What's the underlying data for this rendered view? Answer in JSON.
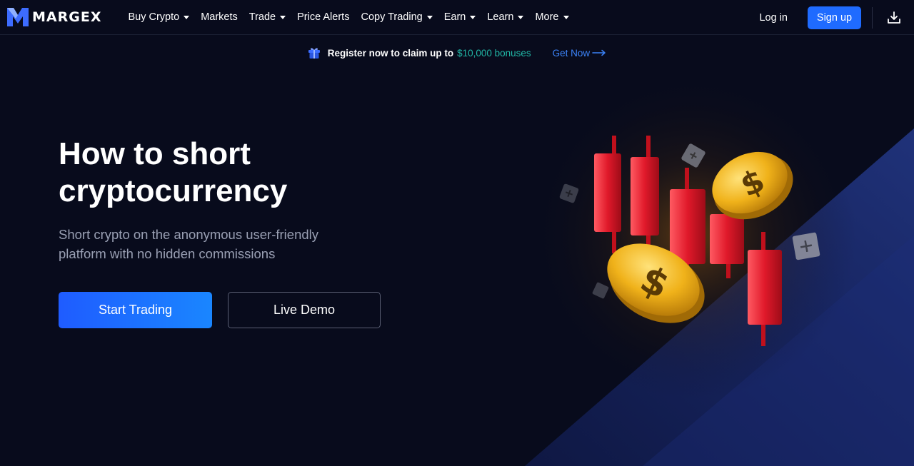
{
  "brand": {
    "name": "MARGEX"
  },
  "nav": {
    "items": [
      {
        "label": "Buy Crypto",
        "has_dropdown": true
      },
      {
        "label": "Markets",
        "has_dropdown": false
      },
      {
        "label": "Trade",
        "has_dropdown": true
      },
      {
        "label": "Price Alerts",
        "has_dropdown": false
      },
      {
        "label": "Copy Trading",
        "has_dropdown": true
      },
      {
        "label": "Earn",
        "has_dropdown": true
      },
      {
        "label": "Learn",
        "has_dropdown": true
      },
      {
        "label": "More",
        "has_dropdown": true
      }
    ],
    "login_label": "Log in",
    "signup_label": "Sign up",
    "download_icon": "download-icon"
  },
  "promo": {
    "icon": "gift-icon",
    "text": "Register now to claim up to",
    "amount": "$10,000 bonuses",
    "link_label": "Get Now",
    "link_icon": "arrow-right-icon"
  },
  "hero": {
    "title_line1": "How to short",
    "title_line2": "cryptocurrency",
    "subtitle_line1": "Short crypto on the anonymous user-friendly",
    "subtitle_line2": "platform with no hidden commissions",
    "primary_button": "Start Trading",
    "secondary_button": "Live Demo",
    "illustration": "candlestick-coins-illustration"
  },
  "colors": {
    "background": "#080b1c",
    "accent": "#1f6bff",
    "bonus": "#21b7a6",
    "link": "#3b82f6",
    "candle": "#e11d2a",
    "coin": "#f0b21a"
  }
}
